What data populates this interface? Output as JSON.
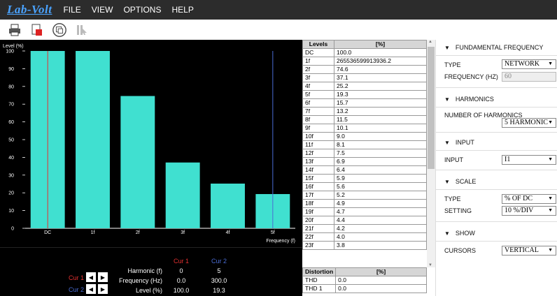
{
  "app": {
    "logo": "Lab-Volt"
  },
  "menu": [
    "FILE",
    "VIEW",
    "OPTIONS",
    "HELP"
  ],
  "toolbar": {
    "icons": [
      "printer-icon",
      "export-icon",
      "screenshot-icon",
      "cursor-disabled-icon"
    ]
  },
  "chart_data": {
    "type": "bar",
    "ylabel": "Level (%)",
    "xlabel": "Frequency (f)",
    "categories": [
      "DC",
      "1f",
      "2f",
      "3f",
      "4f",
      "5f"
    ],
    "values": [
      100,
      100,
      74.6,
      37.1,
      25.2,
      19.3
    ],
    "ylim": [
      0,
      100
    ],
    "yticks": [
      "0",
      "10",
      "20",
      "30",
      "40",
      "50",
      "60",
      "70",
      "80",
      "90",
      "100"
    ],
    "grid": false,
    "colors": {
      "bar": "#40e0d0",
      "cursor1": "#e53030",
      "cursor2": "#4a6cd4",
      "background": "#000000"
    }
  },
  "cursors": {
    "headers": {
      "cur1": "Cur 1",
      "cur2": "Cur 2"
    },
    "rows": [
      {
        "label": "Harmonic (f)",
        "cur1": "0",
        "cur2": "5"
      },
      {
        "label": "Frequency (Hz)",
        "cur1": "0.0",
        "cur2": "300.0"
      },
      {
        "label": "Level (%)",
        "cur1": "100.0",
        "cur2": "19.3"
      }
    ],
    "controls": [
      {
        "label": "Cur 1",
        "color": "#e53030"
      },
      {
        "label": "Cur 2",
        "color": "#4a6cd4"
      }
    ]
  },
  "levels_table": {
    "headers": [
      "Levels",
      "[%]"
    ],
    "rows": [
      [
        "DC",
        "100.0"
      ],
      [
        "1f",
        "265536599913936.2"
      ],
      [
        "2f",
        "74.6"
      ],
      [
        "3f",
        "37.1"
      ],
      [
        "4f",
        "25.2"
      ],
      [
        "5f",
        "19.3"
      ],
      [
        "6f",
        "15.7"
      ],
      [
        "7f",
        "13.2"
      ],
      [
        "8f",
        "11.5"
      ],
      [
        "9f",
        "10.1"
      ],
      [
        "10f",
        "9.0"
      ],
      [
        "11f",
        "8.1"
      ],
      [
        "12f",
        "7.5"
      ],
      [
        "13f",
        "6.9"
      ],
      [
        "14f",
        "6.4"
      ],
      [
        "15f",
        "5.9"
      ],
      [
        "16f",
        "5.6"
      ],
      [
        "17f",
        "5.2"
      ],
      [
        "18f",
        "4.9"
      ],
      [
        "19f",
        "4.7"
      ],
      [
        "20f",
        "4.4"
      ],
      [
        "21f",
        "4.2"
      ],
      [
        "22f",
        "4.0"
      ],
      [
        "23f",
        "3.8"
      ]
    ]
  },
  "distortion_table": {
    "headers": [
      "Distortion",
      "[%]"
    ],
    "rows": [
      [
        "THD",
        "0.0"
      ],
      [
        "THD 1",
        "0.0"
      ]
    ]
  },
  "panel": {
    "fundamental": {
      "title": "FUNDAMENTAL FREQUENCY",
      "type_label": "TYPE",
      "type_value": "NETWORK",
      "freq_label": "FREQUENCY (HZ)",
      "freq_value": "60"
    },
    "harmonics": {
      "title": "HARMONICS",
      "num_label": "NUMBER OF HARMONICS",
      "num_value": "5 HARMONIC"
    },
    "input": {
      "title": "INPUT",
      "input_label": "INPUT",
      "input_value": "I1"
    },
    "scale": {
      "title": "SCALE",
      "type_label": "TYPE",
      "type_value": "% OF DC",
      "setting_label": "SETTING",
      "setting_value": "10 %/DIV"
    },
    "show": {
      "title": "SHOW",
      "cursors_label": "CURSORS",
      "cursors_value": "VERTICAL"
    }
  }
}
